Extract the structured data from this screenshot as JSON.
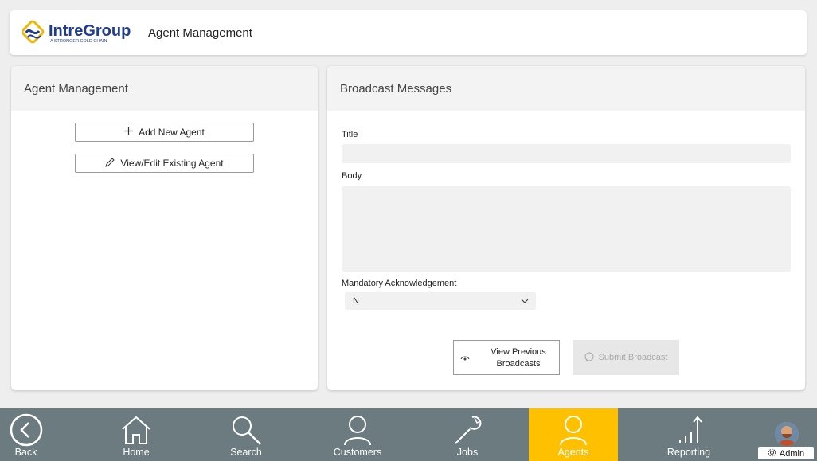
{
  "header": {
    "logo_brand": "IntreGroup",
    "logo_tagline": "A STRONGER COLD CHAIN",
    "title": "Agent Management"
  },
  "left_panel": {
    "title": "Agent Management",
    "add_button": "Add New Agent",
    "edit_button": "View/Edit Existing Agent"
  },
  "right_panel": {
    "title": "Broadcast Messages",
    "title_label": "Title",
    "title_value": "",
    "body_label": "Body",
    "body_value": "",
    "ack_label": "Mandatory Acknowledgement",
    "ack_value": "N",
    "view_prev_button": "View Previous Broadcasts",
    "submit_button": "Submit Broadcast"
  },
  "nav": {
    "items": [
      {
        "label": "Back",
        "icon": "back-circle-icon"
      },
      {
        "label": "Home",
        "icon": "home-icon"
      },
      {
        "label": "Search",
        "icon": "search-icon"
      },
      {
        "label": "Customers",
        "icon": "person-icon"
      },
      {
        "label": "Jobs",
        "icon": "wrench-icon"
      },
      {
        "label": "Agents",
        "icon": "person-icon"
      },
      {
        "label": "Reporting",
        "icon": "chart-icon"
      }
    ],
    "active": "Agents",
    "user_button": "Admin"
  },
  "colors": {
    "nav_bg": "#6b7b80",
    "nav_active": "#ffc000",
    "brand_blue": "#1f3d8f",
    "brand_yellow": "#f2b705"
  }
}
